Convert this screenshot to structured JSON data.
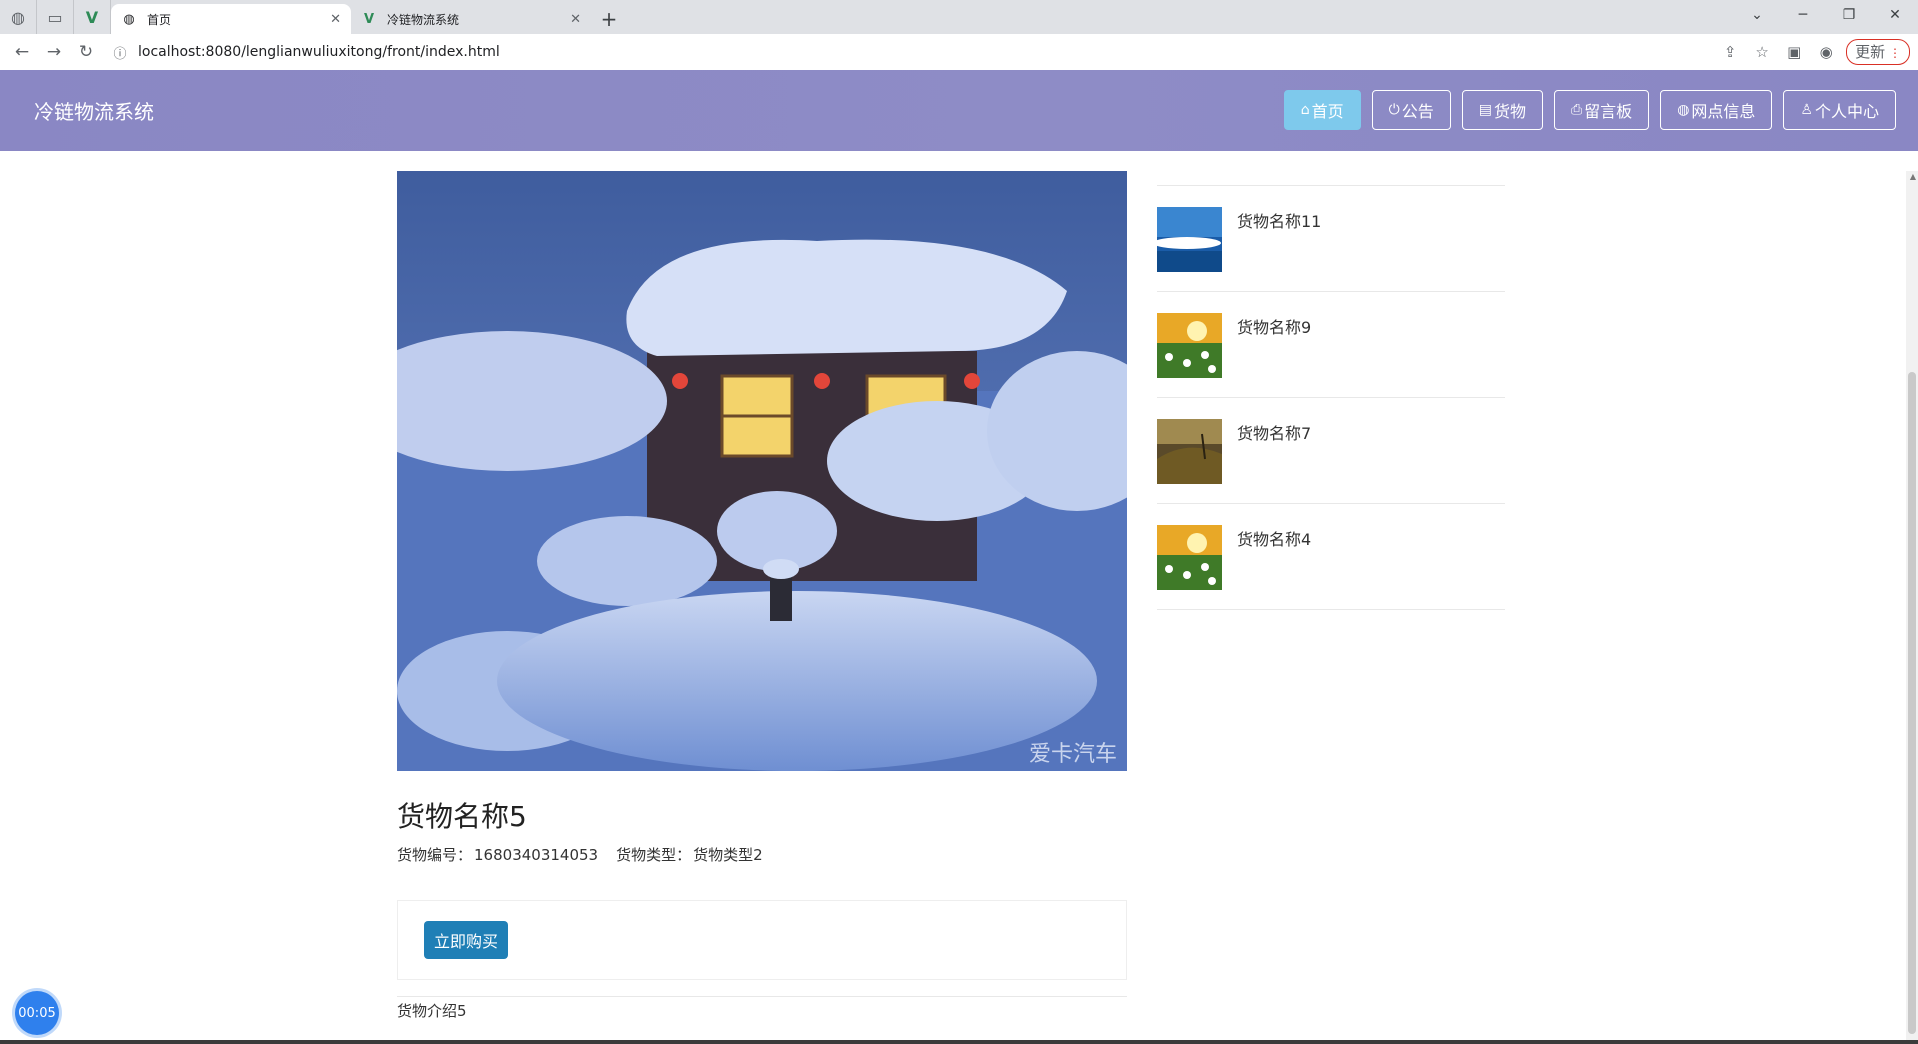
{
  "browser": {
    "tabs": [
      {
        "title": "首页",
        "active": true
      },
      {
        "title": "冷链物流系统",
        "active": false
      }
    ],
    "url": "localhost:8080/lenglianwuliuxitong/front/index.html",
    "update_label": "更新"
  },
  "header": {
    "site_title": "冷链物流系统",
    "nav": [
      {
        "label": "首页",
        "icon": "home-icon",
        "active": true
      },
      {
        "label": "公告",
        "icon": "power-icon",
        "active": false
      },
      {
        "label": "货物",
        "icon": "box-icon",
        "active": false
      },
      {
        "label": "留言板",
        "icon": "printer-icon",
        "active": false
      },
      {
        "label": "网点信息",
        "icon": "globe-icon",
        "active": false
      },
      {
        "label": "个人中心",
        "icon": "user-icon",
        "active": false
      }
    ]
  },
  "product": {
    "name": "货物名称5",
    "code_label": "货物编号：",
    "code": "1680340314053",
    "type_label": "货物类型：",
    "type": "货物类型2",
    "buy_label": "立即购买",
    "intro": "货物介绍5"
  },
  "side_list": [
    {
      "name": "货物名称11",
      "thumb": "sea-sky"
    },
    {
      "name": "货物名称9",
      "thumb": "flower-sunset"
    },
    {
      "name": "货物名称7",
      "thumb": "hill-dusk"
    },
    {
      "name": "货物名称4",
      "thumb": "flower-sunset"
    }
  ],
  "timer": "00:05",
  "colors": {
    "header_bg": "#8e8cc6",
    "nav_active": "#7ec9ec",
    "buy_button": "#1f7fb6"
  }
}
